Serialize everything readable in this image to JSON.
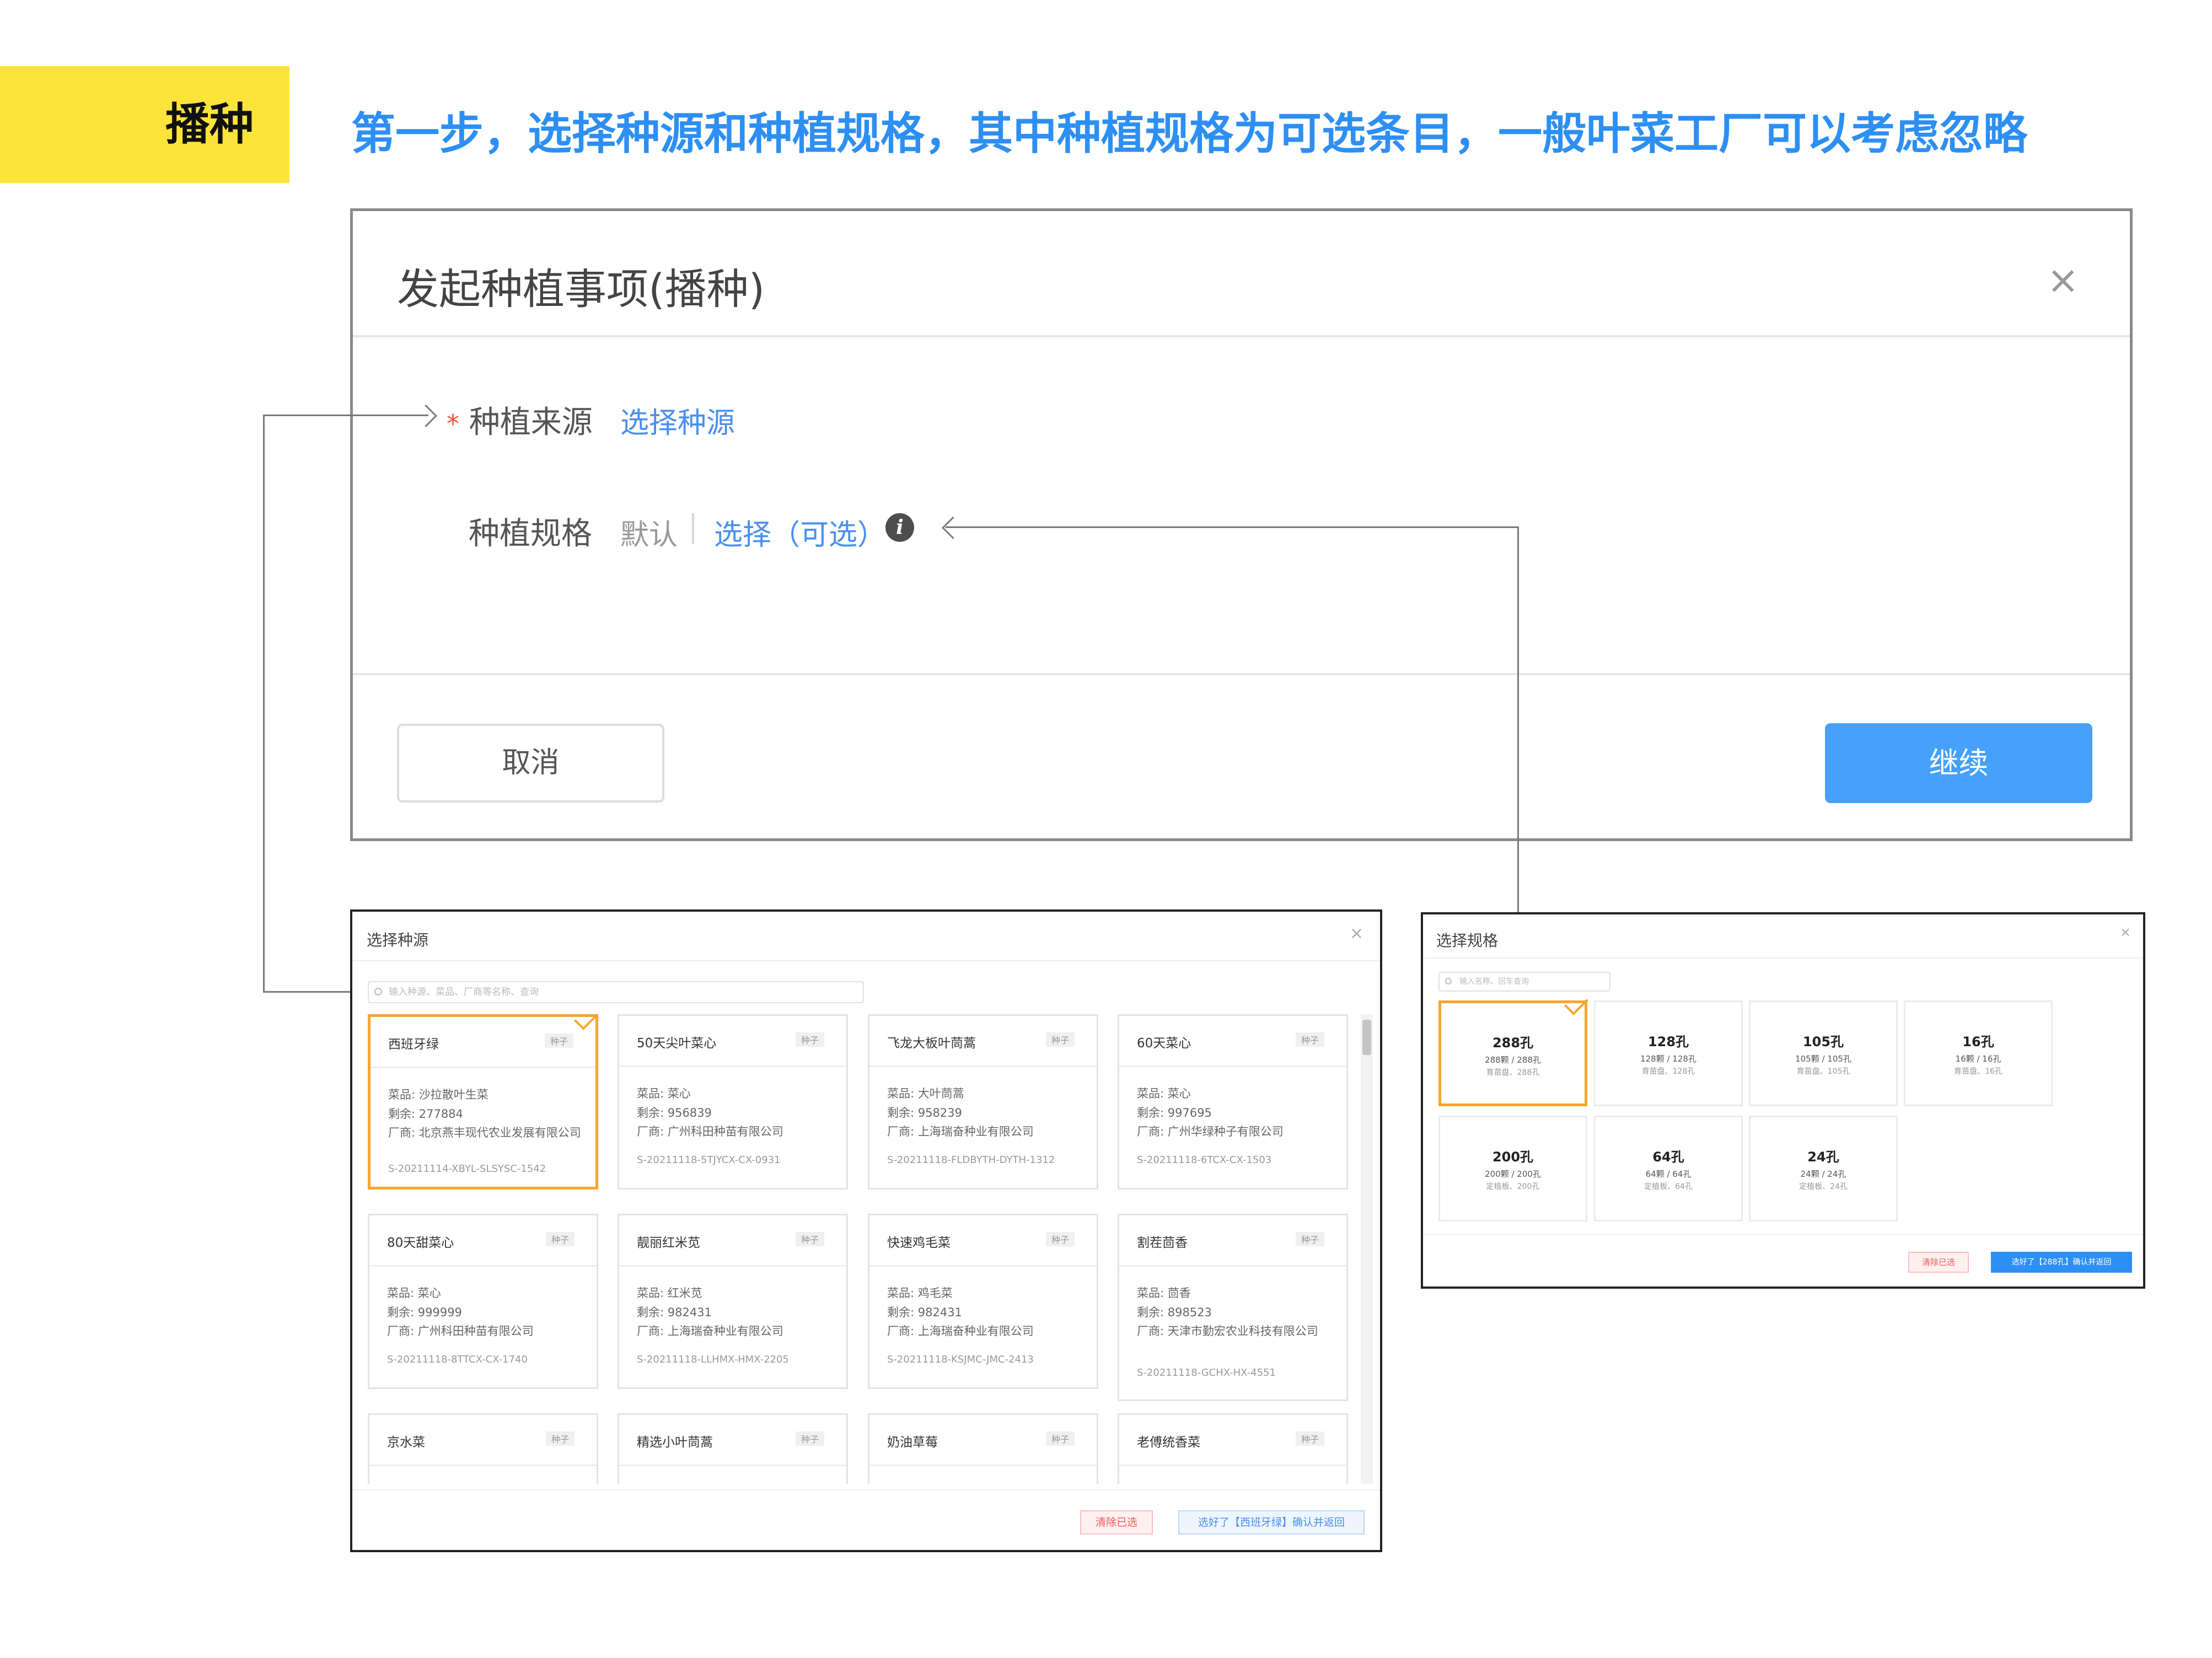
{
  "header": {
    "tag": "播种",
    "headline": "第一步，选择种源和种植规格，其中种植规格为可选条目，一般叶菜工厂可以考虑忽略"
  },
  "main_dialog": {
    "title": "发起种植事项(播种)",
    "close": "×",
    "source_required_mark": "*",
    "source_label": "种植来源",
    "source_link": "选择种源",
    "spec_label": "种植规格",
    "spec_default": "默认",
    "spec_choose": "选择（可选）",
    "info_icon": "i",
    "cancel": "取消",
    "continue": "继续"
  },
  "seed_dialog": {
    "title": "选择种源",
    "close": "×",
    "search_placeholder": "输入种源、菜品、厂商等名称、查询",
    "cards": [
      {
        "name": "西班牙绿",
        "tag": "种子",
        "line1": "菜品: 沙拉散叶生菜",
        "line2": "剩余: 277884",
        "line3": "厂商: 北京燕丰现代农业发展有限公司",
        "code": "S-20211114-XBYL-SLSYSC-1542"
      },
      {
        "name": "50天尖叶菜心",
        "tag": "种子",
        "line1": "菜品: 菜心",
        "line2": "剩余: 956839",
        "line3": "厂商: 广州科田种苗有限公司",
        "code": "S-20211118-5TJYCX-CX-0931"
      },
      {
        "name": "飞龙大板叶茼蒿",
        "tag": "种子",
        "line1": "菜品: 大叶茼蒿",
        "line2": "剩余: 958239",
        "line3": "厂商: 上海瑞奋种业有限公司",
        "code": "S-20211118-FLDBYTH-DYTH-1312"
      },
      {
        "name": "60天菜心",
        "tag": "种子",
        "line1": "菜品: 菜心",
        "line2": "剩余: 997695",
        "line3": "厂商: 广州华绿种子有限公司",
        "code": "S-20211118-6TCX-CX-1503"
      },
      {
        "name": "80天甜菜心",
        "tag": "种子",
        "line1": "菜品: 菜心",
        "line2": "剩余: 999999",
        "line3": "厂商: 广州科田种苗有限公司",
        "code": "S-20211118-8TTCX-CX-1740"
      },
      {
        "name": "靓丽红米苋",
        "tag": "种子",
        "line1": "菜品: 红米苋",
        "line2": "剩余: 982431",
        "line3": "厂商: 上海瑞奋种业有限公司",
        "code": "S-20211118-LLHMX-HMX-2205"
      },
      {
        "name": "快速鸡毛菜",
        "tag": "种子",
        "line1": "菜品: 鸡毛菜",
        "line2": "剩余: 982431",
        "line3": "厂商: 上海瑞奋种业有限公司",
        "code": "S-20211118-KSJMC-JMC-2413"
      },
      {
        "name": "割茬茴香",
        "tag": "种子",
        "line1": "菜品: 茴香",
        "line2": "剩余: 898523",
        "line3": "厂商: 天津市勤宏农业科技有限公司",
        "code": "S-20211118-GCHX-HX-4551"
      },
      {
        "name": "京水菜",
        "tag": "种子"
      },
      {
        "name": "精选小叶茼蒿",
        "tag": "种子"
      },
      {
        "name": "奶油草莓",
        "tag": "种子"
      },
      {
        "name": "老傅统香菜",
        "tag": "种子"
      }
    ],
    "clear_btn": "清除已选",
    "confirm_btn": "选好了【西班牙绿】确认并返回"
  },
  "spec_dialog": {
    "title": "选择规格",
    "close": "×",
    "search_placeholder": "输入名称、回车查询",
    "specs": [
      {
        "name": "288孔",
        "sub": "288颗 / 288孔",
        "note": "育苗盘、288孔"
      },
      {
        "name": "128孔",
        "sub": "128颗 / 128孔",
        "note": "育苗盘、128孔"
      },
      {
        "name": "105孔",
        "sub": "105颗 / 105孔",
        "note": "育苗盘、105孔"
      },
      {
        "name": "16孔",
        "sub": "16颗 / 16孔",
        "note": "育苗盘、16孔"
      },
      {
        "name": "200孔",
        "sub": "200颗 / 200孔",
        "note": "定植板、200孔"
      },
      {
        "name": "64孔",
        "sub": "64颗 / 64孔",
        "note": "定植板、64孔"
      },
      {
        "name": "24孔",
        "sub": "24颗 / 24孔",
        "note": "定植板、24孔"
      }
    ],
    "clear_btn": "清除已选",
    "confirm_btn": "选好了【288孔】确认并返回"
  },
  "colors": {
    "accent_yellow": "#fce33a",
    "headline_blue": "#2d8ff3",
    "primary_button": "#46a0fc",
    "selected_border": "#f7a531",
    "required_red": "#f5533d"
  }
}
